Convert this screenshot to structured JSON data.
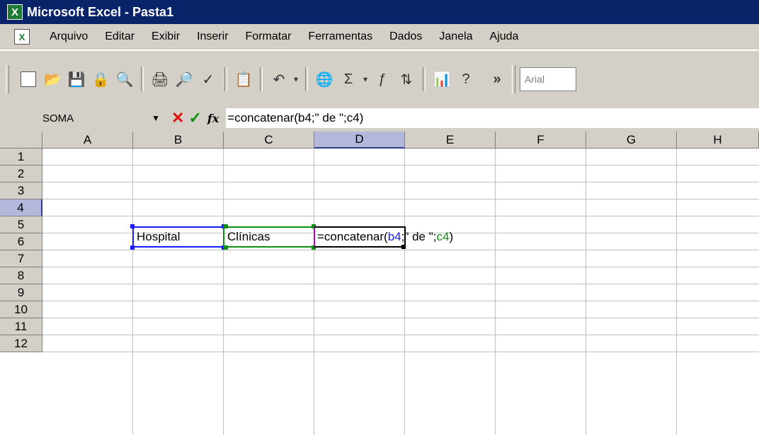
{
  "window": {
    "title": "Microsoft Excel - Pasta1"
  },
  "menu": {
    "items": [
      "Arquivo",
      "Editar",
      "Exibir",
      "Inserir",
      "Formatar",
      "Ferramentas",
      "Dados",
      "Janela",
      "Ajuda"
    ]
  },
  "toolbar": {
    "icons": [
      "new-icon",
      "open-icon",
      "save-icon",
      "permission-icon",
      "search-icon",
      "print-icon",
      "print-preview-icon",
      "spelling-icon",
      "paste-icon",
      "undo-icon",
      "hyperlink-icon",
      "autosum-icon",
      "function-icon",
      "sort-ascending-icon",
      "chart-icon",
      "help-icon"
    ],
    "more_label": "»",
    "font_value": "Arial"
  },
  "formula_bar": {
    "name_box": "SOMA",
    "fx_label": "fx",
    "formula": "=concatenar(b4;\" de \";c4)"
  },
  "grid": {
    "columns": [
      "A",
      "B",
      "C",
      "D",
      "E",
      "F",
      "G",
      "H"
    ],
    "rows": [
      "1",
      "2",
      "3",
      "4",
      "5",
      "6",
      "7",
      "8",
      "9",
      "10",
      "11",
      "12"
    ],
    "selected_column": "D",
    "selected_row": "4",
    "cells": {
      "B4": "Hospital",
      "C4": "Clínicas",
      "D4_prefix": "=concatenar(",
      "D4_ref1": "b4",
      "D4_mid": ";\" de \";",
      "D4_ref2": "c4",
      "D4_suffix": ")"
    }
  },
  "colors": {
    "title_bar": "#0a246a",
    "ref_b": "#1a1aff",
    "ref_c": "#109010",
    "selected_header": "#b3b7d9"
  }
}
